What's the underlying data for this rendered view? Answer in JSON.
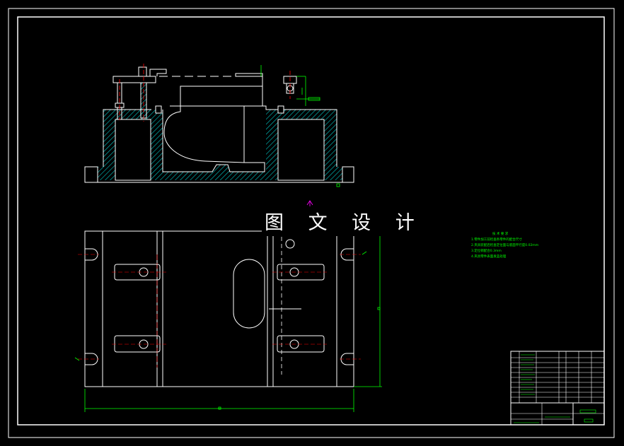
{
  "drawing": {
    "colors": {
      "background": "#000000",
      "outline": "#ffffff",
      "hatch": "#00c8c8",
      "centerline": "#ff0000",
      "dimension": "#00ff00",
      "marker": "#ff00ff"
    },
    "watermark": "图 文 设 计",
    "notes": {
      "title": "技 术 要 求",
      "lines": [
        "1.零件加工前检查各零件的配合尺寸",
        "2.夹具装配后检查定位面与底面平行度0.02mm",
        "3.定位销配合0.3mm",
        "4.夹具零件表面发蓝处理"
      ]
    },
    "title_block": {
      "rows": 12,
      "icons": [
        "section-arrow-icon",
        "surface-roughness-icon",
        "datum-icon"
      ]
    }
  }
}
